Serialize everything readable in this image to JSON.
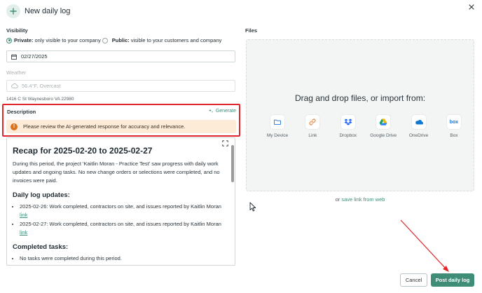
{
  "header": {
    "title": "New daily log"
  },
  "visibility": {
    "label": "Visibility",
    "private_label": "Private:",
    "private_desc": "only visible to your company",
    "public_label": "Public:",
    "public_desc": "visible to your customers and company",
    "selected": "private"
  },
  "date": {
    "value": "02/27/2025"
  },
  "weather": {
    "label": "Weather",
    "value": "56.4°F, Overcast",
    "address": "1416 C St Waynesboro VA 22980"
  },
  "description": {
    "label": "Description",
    "generate_label": "Generate",
    "warning": "Please review the AI-generated response for accuracy and relevance."
  },
  "editor": {
    "title": "Recap for 2025-02-20 to 2025-02-27",
    "intro": "During this period, the project 'Kaitlin Moran - Practice Test' saw progress with daily work updates and ongoing tasks. No new change orders or selections were completed, and no invoices were paid.",
    "daily_heading": "Daily log updates:",
    "daily_items": [
      {
        "text": "2025-02-26: Work completed, contractors on site, and issues reported by Kaitlin Moran",
        "link": "link"
      },
      {
        "text": "2025-02-27: Work completed, contractors on site, and issues reported by Kaitlin Moran",
        "link": "link"
      }
    ],
    "completed_heading": "Completed tasks:",
    "completed_items": [
      "No tasks were completed during this period."
    ]
  },
  "files": {
    "label": "Files",
    "drop_text": "Drag and drop files, or import from:",
    "sources": [
      "My Device",
      "Link",
      "Dropbox",
      "Google Drive",
      "OneDrive",
      "Box"
    ],
    "box_icon_text": "box",
    "web_prefix": "or",
    "web_link": "save link from web"
  },
  "actions": {
    "cancel": "Cancel",
    "post": "Post daily log"
  },
  "colors": {
    "accent": "#3f8c79",
    "annotation": "#e0252b",
    "warning_bg": "#fdebd8"
  }
}
